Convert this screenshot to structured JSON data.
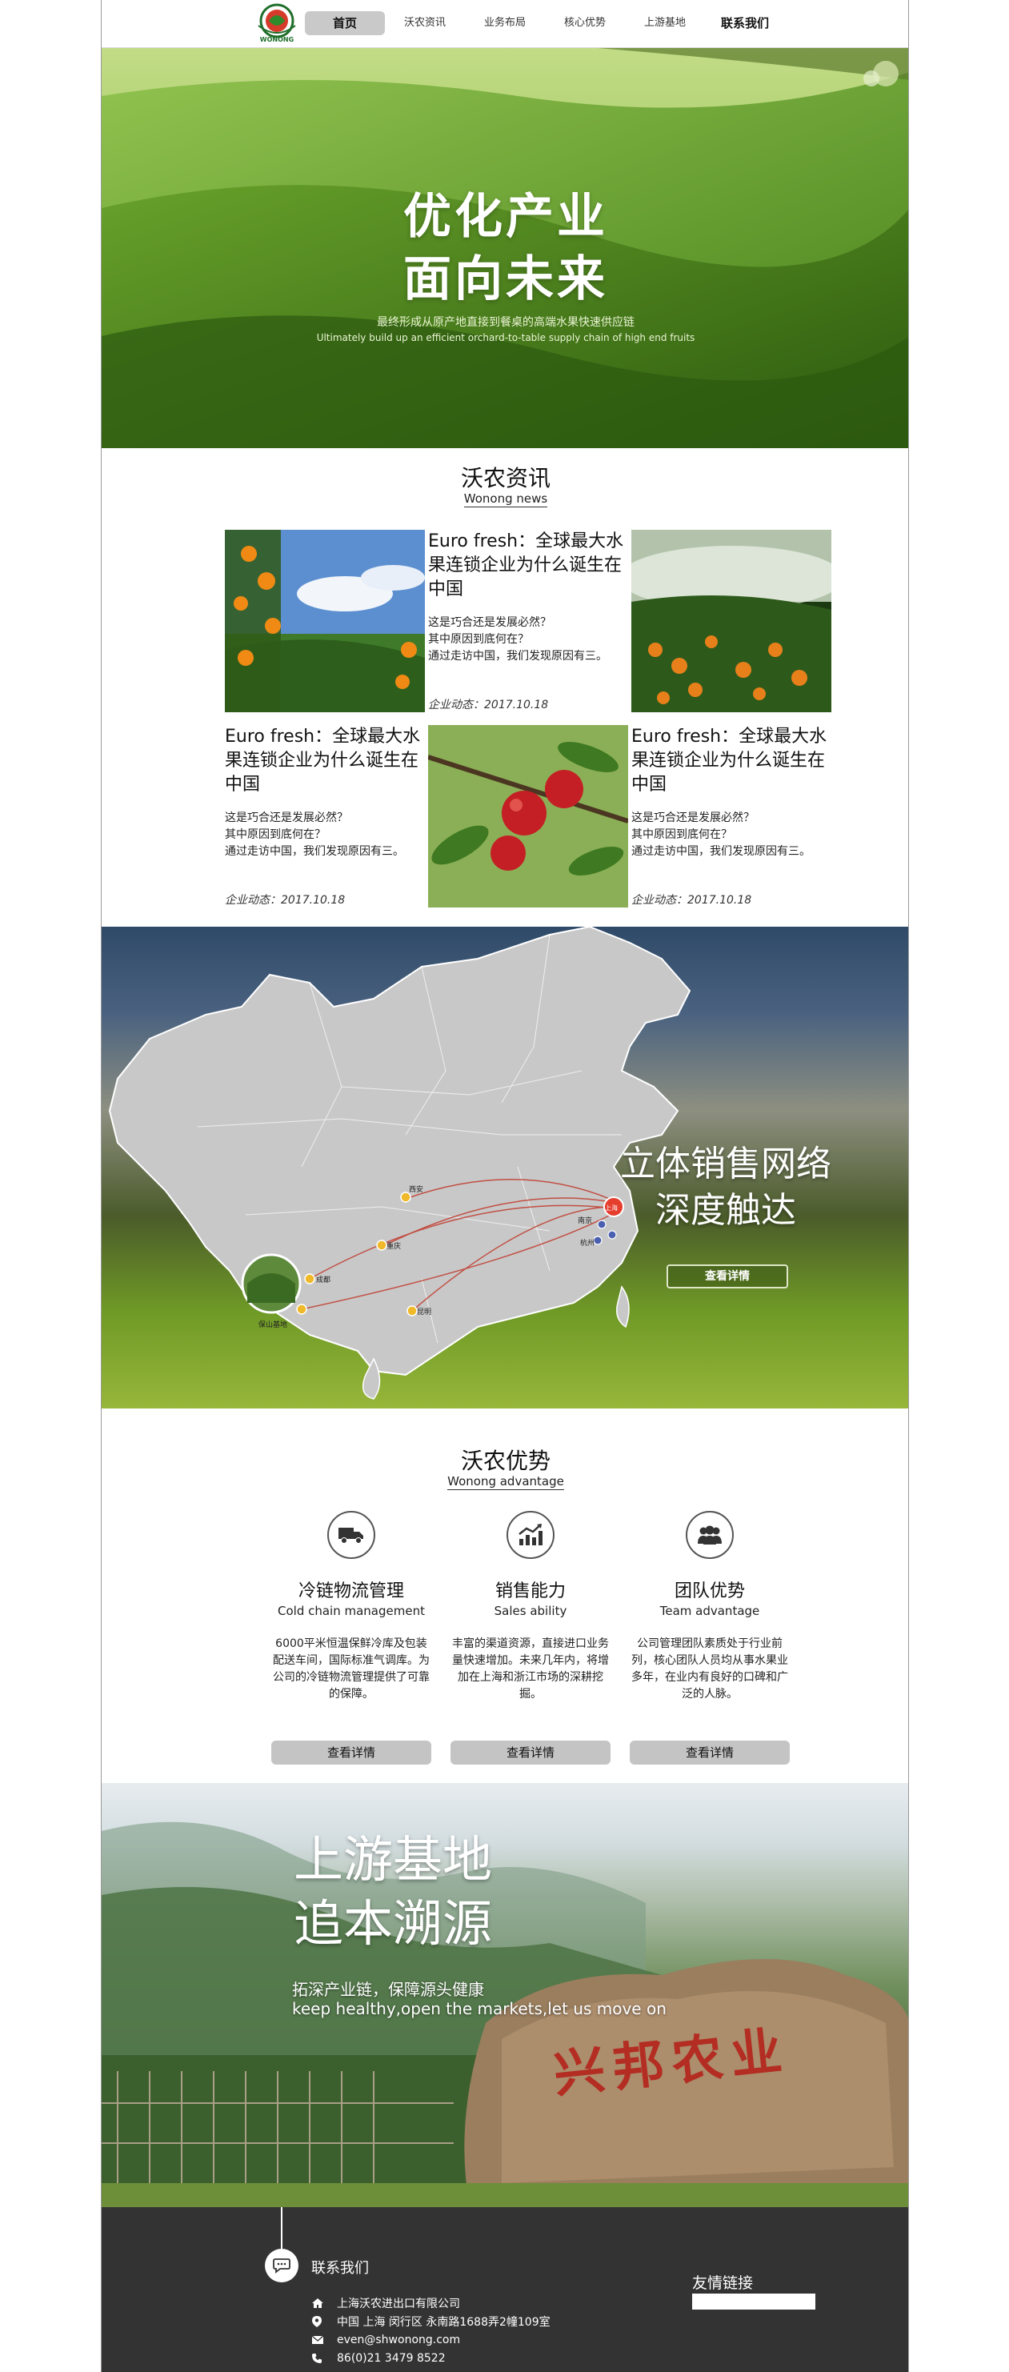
{
  "nav": {
    "logo_text": "WONONG",
    "items": [
      {
        "label": "首页",
        "active": true
      },
      {
        "label": "沃农资讯"
      },
      {
        "label": "业务布局"
      },
      {
        "label": "核心优势"
      },
      {
        "label": "上游基地"
      },
      {
        "label": "联系我们"
      }
    ]
  },
  "hero": {
    "title_line1": "优化产业",
    "title_line2": "面向未来",
    "subtitle_cn": "最终形成从原产地直接到餐桌的高端水果快速供应链",
    "subtitle_en": "Ultimately build up an efficient orchard-to-table supply chain of high end fruits"
  },
  "news": {
    "title": "沃农资讯",
    "subtitle": "Wonong news",
    "cards": [
      {
        "title": "Euro fresh：全球最大水果连锁企业为什么诞生在中国",
        "desc_lines": [
          "这是巧合还是发展必然？",
          "其中原因到底何在？",
          "通过走访中国，我们发现原因有三。"
        ],
        "meta": "企业动态：2017.10.18"
      },
      {
        "title": "Euro fresh：全球最大水果连锁企业为什么诞生在中国",
        "desc_lines": [
          "这是巧合还是发展必然？",
          "其中原因到底何在？",
          "通过走访中国，我们发现原因有三。"
        ],
        "meta": "企业动态：2017.10.18"
      },
      {
        "title": "Euro fresh：全球最大水果连锁企业为什么诞生在中国",
        "desc_lines": [
          "这是巧合还是发展必然？",
          "其中原因到底何在？",
          "通过走访中国，我们发现原因有三。"
        ],
        "meta": "企业动态：2017.10.18"
      }
    ]
  },
  "network": {
    "title_line1": "立体销售网络",
    "title_line2": "深度触达",
    "button": "查看详情",
    "map_labels": [
      "西安",
      "成都",
      "重庆",
      "昆明",
      "保山基地",
      "上海",
      "杭州",
      "南京"
    ]
  },
  "advantage": {
    "title": "沃农优势",
    "subtitle": "Wonong advantage",
    "items": [
      {
        "icon": "truck-icon",
        "title": "冷链物流管理",
        "en": "Cold chain management",
        "desc": "6000平米恒温保鲜冷库及包装配送车间，国际标准气调库。为公司的冷链物流管理提供了可靠的保障。",
        "button": "查看详情"
      },
      {
        "icon": "chart-icon",
        "title": "销售能力",
        "en": "Sales ability",
        "desc": "丰富的渠道资源，直接进口业务量快速增加。未来几年内，将增加在上海和浙江市场的深耕挖掘。",
        "button": "查看详情"
      },
      {
        "icon": "team-icon",
        "title": "团队优势",
        "en": "Team advantage",
        "desc": "公司管理团队素质处于行业前列，核心团队人员均从事水果业多年，在业内有良好的口碑和广泛的人脉。",
        "button": "查看详情"
      }
    ]
  },
  "base": {
    "title_line1": "上游基地",
    "title_line2": "追本溯源",
    "subtitle_cn": "拓深产业链，保障源头健康",
    "subtitle_en": "keep healthy,open the markets,let us move on",
    "stone_text": "兴邦农业"
  },
  "footer": {
    "contact_label": "联系我们",
    "company": "上海沃农进出口有限公司",
    "address": "中国 上海 闵行区 永南路1688弄2幢109室",
    "email": "even@shwonong.com",
    "phone": "86(0)21 3479 8522",
    "friend_links": "友情链接"
  },
  "colors": {
    "nav_active_bg": "#c9c9c9",
    "button_gray": "#c4c4c4",
    "footer_bg": "#333333",
    "stone_red": "#b4231c"
  }
}
